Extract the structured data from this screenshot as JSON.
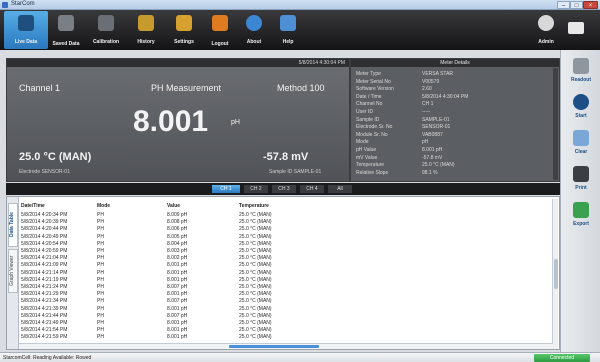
{
  "window": {
    "title": "StarCom"
  },
  "toolbar": {
    "buttons": [
      {
        "label": "Live Data",
        "icon": "live-data-icon",
        "active": true
      },
      {
        "label": "Saved Data",
        "icon": "saved-data-icon"
      },
      {
        "label": "Calibration",
        "icon": "calibration-icon"
      },
      {
        "label": "History",
        "icon": "history-icon"
      },
      {
        "label": "Settings",
        "icon": "settings-icon"
      },
      {
        "label": "Logout",
        "icon": "logout-icon"
      },
      {
        "label": "About",
        "icon": "about-icon"
      },
      {
        "label": "Help",
        "icon": "help-icon"
      }
    ],
    "admin_label": "Admin",
    "admin_icon": "admin-user-icon"
  },
  "sidebar": {
    "buttons": [
      {
        "label": "Readout",
        "icon": "readout-icon"
      },
      {
        "label": "Start",
        "icon": "start-icon"
      },
      {
        "label": "Clear",
        "icon": "clear-icon"
      },
      {
        "label": "Print",
        "icon": "printer-icon"
      },
      {
        "label": "Export",
        "icon": "export-icon"
      }
    ]
  },
  "measurement": {
    "timestamp": "5/8/2014 4:30:04 PM",
    "channel": "Channel 1",
    "mode_title": "PH Measurement",
    "method": "Method 100",
    "value": "8.001",
    "unit": "pH",
    "temperature": "25.0 °C (MAN)",
    "mv": "-57.8 mV",
    "electrode": "Electrode SENSOR-01",
    "sample": "Sample ID SAMPLE-01"
  },
  "details": {
    "title": "Meter Details",
    "rows": [
      {
        "k": "Meter Type",
        "v": "VERSA STAR"
      },
      {
        "k": "Meter Serial No",
        "v": "V00579"
      },
      {
        "k": "Software Version",
        "v": "2.60"
      },
      {
        "k": "Date / Time",
        "v": "5/8/2014 4:30:04 PM"
      },
      {
        "k": "Channel No",
        "v": "CH 1"
      },
      {
        "k": "User ID",
        "v": "-----"
      },
      {
        "k": "Sample ID",
        "v": "SAMPLE-01"
      },
      {
        "k": "Electrode Sr. No",
        "v": "SENSOR-01"
      },
      {
        "k": "Module Sr. No",
        "v": "VAB0887"
      },
      {
        "k": "Mode",
        "v": "pH"
      },
      {
        "k": "pH Value",
        "v": "8.001 pH"
      },
      {
        "k": "mV Value",
        "v": "-57.8 mV"
      },
      {
        "k": "Temperature",
        "v": "25.0 °C (MAN)"
      },
      {
        "k": "Relative Slope",
        "v": "98.1 %"
      }
    ]
  },
  "viewbar": {
    "tabs": [
      "CH 1",
      "CH 2",
      "CH 3",
      "CH 4",
      "All"
    ],
    "active": 0
  },
  "table": {
    "side_tabs": [
      "Data Table",
      "Graph Viewer"
    ],
    "headers": [
      "Date/Time",
      "Mode",
      "Value",
      "Temperature"
    ],
    "rows": [
      [
        "5/8/2014 4:20:34 PM",
        "PH",
        "8.009 pH",
        "25.0 °C (MAN)"
      ],
      [
        "5/8/2014 4:20:39 PM",
        "PH",
        "8.008 pH",
        "25.0 °C (MAN)"
      ],
      [
        "5/8/2014 4:20:44 PM",
        "PH",
        "8.006 pH",
        "25.0 °C (MAN)"
      ],
      [
        "5/8/2014 4:20:49 PM",
        "PH",
        "8.005 pH",
        "25.0 °C (MAN)"
      ],
      [
        "5/8/2014 4:20:54 PM",
        "PH",
        "8.004 pH",
        "25.0 °C (MAN)"
      ],
      [
        "5/8/2014 4:20:59 PM",
        "PH",
        "8.003 pH",
        "25.0 °C (MAN)"
      ],
      [
        "5/8/2014 4:21:04 PM",
        "PH",
        "8.002 pH",
        "25.0 °C (MAN)"
      ],
      [
        "5/8/2014 4:21:09 PM",
        "PH",
        "8.001 pH",
        "25.0 °C (MAN)"
      ],
      [
        "5/8/2014 4:21:14 PM",
        "PH",
        "8.001 pH",
        "25.0 °C (MAN)"
      ],
      [
        "5/8/2014 4:21:19 PM",
        "PH",
        "8.001 pH",
        "25.0 °C (MAN)"
      ],
      [
        "5/8/2014 4:21:24 PM",
        "PH",
        "8.007 pH",
        "25.0 °C (MAN)"
      ],
      [
        "5/8/2014 4:21:29 PM",
        "PH",
        "8.001 pH",
        "25.0 °C (MAN)"
      ],
      [
        "5/8/2014 4:21:34 PM",
        "PH",
        "8.007 pH",
        "25.0 °C (MAN)"
      ],
      [
        "5/8/2014 4:21:39 PM",
        "PH",
        "8.001 pH",
        "25.0 °C (MAN)"
      ],
      [
        "5/8/2014 4:21:44 PM",
        "PH",
        "8.007 pH",
        "25.0 °C (MAN)"
      ],
      [
        "5/8/2014 4:21:49 PM",
        "PH",
        "8.001 pH",
        "25.0 °C (MAN)"
      ],
      [
        "5/8/2014 4:21:54 PM",
        "PH",
        "8.001 pH",
        "25.0 °C (MAN)"
      ],
      [
        "5/8/2014 4:21:59 PM",
        "PH",
        "8.001 pH",
        "25.0 °C (MAN)"
      ]
    ]
  },
  "statusbar": {
    "text": "StarcomCell: Reading Available: Rowed",
    "connection": "Connected"
  }
}
